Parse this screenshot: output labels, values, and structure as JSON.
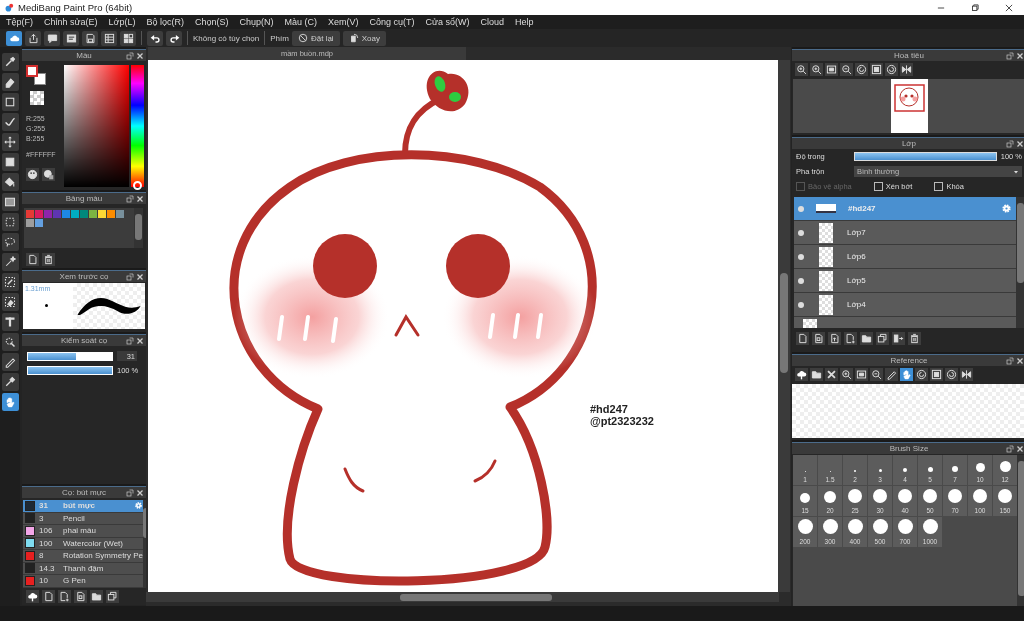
{
  "window": {
    "title": "MediBang Paint Pro (64bit)"
  },
  "menu": [
    "Tệp(F)",
    "Chỉnh sửa(E)",
    "Lớp(L)",
    "Bộ lọc(R)",
    "Chọn(S)",
    "Chụp(N)",
    "Màu (C)",
    "Xem(V)",
    "Công cụ(T)",
    "Cửa sổ(W)",
    "Cloud",
    "Help"
  ],
  "toolbar": {
    "option_text": "Không có tùy chọn",
    "key_label": "Phím",
    "reset_button": "Đặt lại",
    "rotate_button": "Xoay"
  },
  "tools": [
    {
      "kind": "brush",
      "selected": false
    },
    {
      "kind": "eraser",
      "selected": false
    },
    {
      "kind": "rectangle",
      "selected": false
    },
    {
      "kind": "check",
      "selected": false
    },
    {
      "kind": "move",
      "selected": false
    },
    {
      "kind": "fill",
      "selected": false
    },
    {
      "kind": "bucket",
      "selected": false
    },
    {
      "kind": "gradient",
      "selected": false
    },
    {
      "kind": "select",
      "selected": false
    },
    {
      "kind": "lasso",
      "selected": false
    },
    {
      "kind": "wand",
      "selected": false
    },
    {
      "kind": "selpen",
      "selected": false
    },
    {
      "kind": "selerase",
      "selected": false
    },
    {
      "kind": "text",
      "selected": false
    },
    {
      "kind": "selmove",
      "selected": false
    },
    {
      "kind": "pen",
      "selected": false
    },
    {
      "kind": "dropper",
      "selected": false
    },
    {
      "kind": "hand",
      "selected": true
    }
  ],
  "color_panel": {
    "title": "Màu",
    "rgb": [
      "R:255",
      "G:255",
      "B:255"
    ],
    "hex": "#FFFFFF"
  },
  "palette_panel": {
    "title": "Bảng màu",
    "swatches": [
      {
        "color": "#e53935"
      },
      {
        "color": "#d81b60"
      },
      {
        "color": "#8e24aa"
      },
      {
        "color": "#5e35b1"
      },
      {
        "color": "#1e88e5"
      },
      {
        "color": "#00acc1"
      },
      {
        "color": "#00897b"
      },
      {
        "color": "#7cb342"
      },
      {
        "color": "#fdd835"
      },
      {
        "color": "#fb8c00"
      },
      {
        "color": "#78909c"
      },
      {
        "color": "#9e9e9e"
      },
      {
        "color": "#64a0e0"
      }
    ]
  },
  "brush_preview": {
    "title": "Xem trước cọ",
    "size": "1.31mm"
  },
  "brush_control": {
    "title": "Kiểm soát cọ",
    "size": {
      "level": 0.57,
      "value": "31"
    },
    "opacity": {
      "level": 1,
      "reading": "100 %"
    }
  },
  "brush_list": {
    "title": "Cọ: bút mực",
    "items": [
      {
        "size": "31",
        "name": "bút mực",
        "color": "#1e2a36",
        "selected": true
      },
      {
        "size": "3",
        "name": "Pencil",
        "color": "#222222",
        "selected": false
      },
      {
        "size": "106",
        "name": "phai màu",
        "color": "#f3a6e8",
        "selected": false
      },
      {
        "size": "100",
        "name": "Watercolor (Wet)",
        "color": "#7fdcf0",
        "selected": false
      },
      {
        "size": "8",
        "name": "Rotation Symmetry Pe",
        "color": "#e82020",
        "selected": false
      },
      {
        "size": "14.3",
        "name": "Thanh đậm",
        "color": "#222222",
        "selected": false
      },
      {
        "size": "10",
        "name": "G Pen",
        "color": "#e82020",
        "selected": false
      }
    ]
  },
  "document": {
    "tab": "mầm buồn.mdp",
    "texts": [
      "#hd247",
      "@pt2323232"
    ]
  },
  "navigator": {
    "title": "Hoa tiêu"
  },
  "layers": {
    "title": "Lớp",
    "opacity": {
      "label": "Độ trong",
      "level": 1,
      "reading": "100 %"
    },
    "blend": {
      "label": "Pha trộn",
      "value": "Bình thường"
    },
    "options": [
      {
        "label": "Bảo vệ alpha",
        "checked": false,
        "disabled": true
      },
      {
        "label": "Xén bớt",
        "checked": false,
        "disabled": false
      },
      {
        "label": "Khóa",
        "checked": false,
        "disabled": false
      }
    ],
    "items": [
      {
        "name": "#hd247",
        "kind": "text",
        "visible": true,
        "selected": true
      },
      {
        "name": "Lớp7",
        "kind": "raster",
        "visible": true,
        "selected": false
      },
      {
        "name": "Lớp6",
        "kind": "raster",
        "visible": true,
        "selected": false
      },
      {
        "name": "Lớp5",
        "kind": "raster",
        "visible": true,
        "selected": false
      },
      {
        "name": "Lớp4",
        "kind": "raster",
        "visible": true,
        "selected": false
      }
    ]
  },
  "reference": {
    "title": "Reference"
  },
  "brush_size": {
    "title": "Brush Size",
    "sizes": [
      "1",
      "1.5",
      "2",
      "3",
      "4",
      "5",
      "7",
      "10",
      "12",
      "15",
      "20",
      "25",
      "30",
      "40",
      "50",
      "70",
      "100",
      "150",
      "200",
      "300",
      "400",
      "500",
      "700",
      "1000"
    ]
  }
}
